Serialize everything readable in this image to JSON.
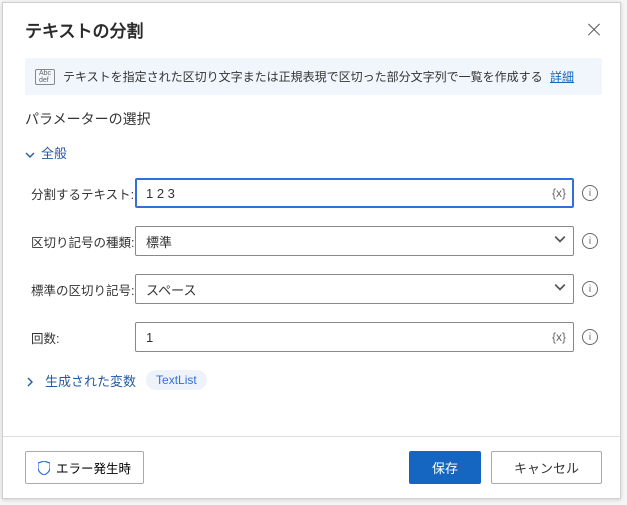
{
  "header": {
    "title": "テキストの分割"
  },
  "banner": {
    "text": "テキストを指定された区切り文字または正規表現で区切った部分文字列で一覧を作成する",
    "link": "詳細"
  },
  "section": {
    "title": "パラメーターの選択"
  },
  "group": {
    "general": "全般"
  },
  "fields": {
    "text_to_split": {
      "label": "分割するテキスト:",
      "value": "1 2  3"
    },
    "delimiter_type": {
      "label": "区切り記号の種類:",
      "value": "標準"
    },
    "standard_delimiter": {
      "label": "標準の区切り記号:",
      "value": "スペース"
    },
    "times": {
      "label": "回数:",
      "value": "1"
    }
  },
  "generated": {
    "label": "生成された変数",
    "chip": "TextList"
  },
  "footer": {
    "on_error": "エラー発生時",
    "save": "保存",
    "cancel": "キャンセル"
  }
}
